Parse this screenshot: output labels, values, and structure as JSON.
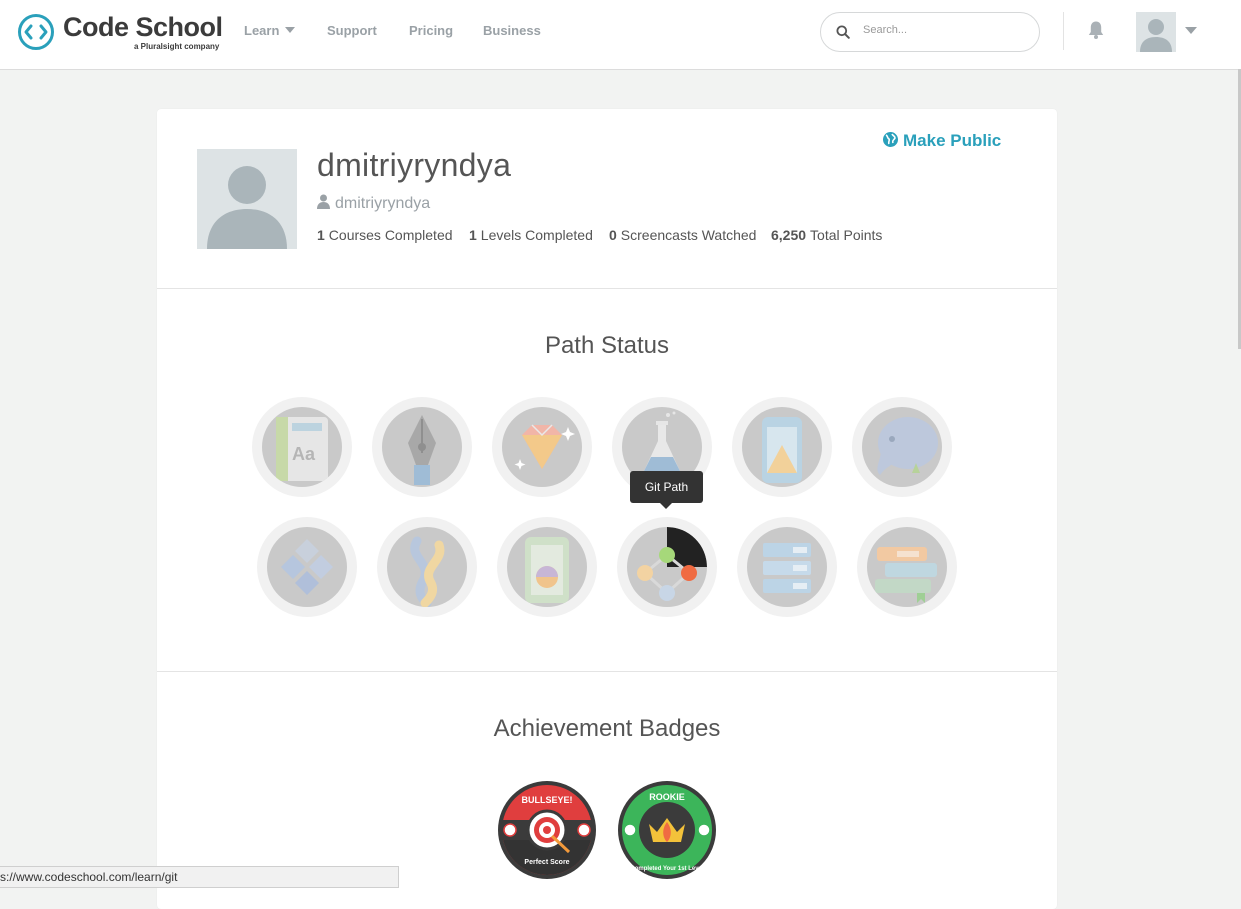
{
  "header": {
    "logo_title": "Code School",
    "logo_subtitle": "a Pluralsight company",
    "nav": [
      {
        "label": "Learn",
        "has_dropdown": true
      },
      {
        "label": "Support"
      },
      {
        "label": "Pricing"
      },
      {
        "label": "Business"
      }
    ],
    "search_placeholder": "Search...",
    "accent_color": "#2aa0bb"
  },
  "profile": {
    "name": "dmitriyryndya",
    "username": "dmitriyryndya",
    "make_public_label": "Make Public",
    "stats": [
      {
        "value": "1",
        "label": "Courses Completed"
      },
      {
        "value": "1",
        "label": "Levels Completed"
      },
      {
        "value": "0",
        "label": "Screencasts Watched"
      },
      {
        "value": "6,250",
        "label": "Total Points"
      }
    ]
  },
  "path_status": {
    "title": "Path Status",
    "paths": [
      {
        "icon": "html-css-path-icon"
      },
      {
        "icon": "design-pen-path-icon"
      },
      {
        "icon": "ruby-gem-path-icon"
      },
      {
        "icon": "javascript-flask-path-icon"
      },
      {
        "icon": "ios-device-path-icon"
      },
      {
        "icon": "php-elephant-path-icon"
      },
      {
        "icon": "dotnet-diamonds-path-icon"
      },
      {
        "icon": "python-snakes-path-icon"
      },
      {
        "icon": "android-device-path-icon"
      },
      {
        "icon": "git-nodes-path-icon",
        "tooltip": "Git Path",
        "progress": 0.25
      },
      {
        "icon": "database-server-path-icon"
      },
      {
        "icon": "books-path-icon"
      }
    ]
  },
  "achievements": {
    "title": "Achievement Badges",
    "badges": [
      {
        "name": "BULLSEYE!",
        "caption": "Perfect Score",
        "color": "#e03e3e"
      },
      {
        "name": "ROOKIE",
        "caption": "Completed Your 1st Level",
        "color": "#3cb55a"
      }
    ]
  },
  "status_bar": {
    "url": "s://www.codeschool.com/learn/git"
  }
}
